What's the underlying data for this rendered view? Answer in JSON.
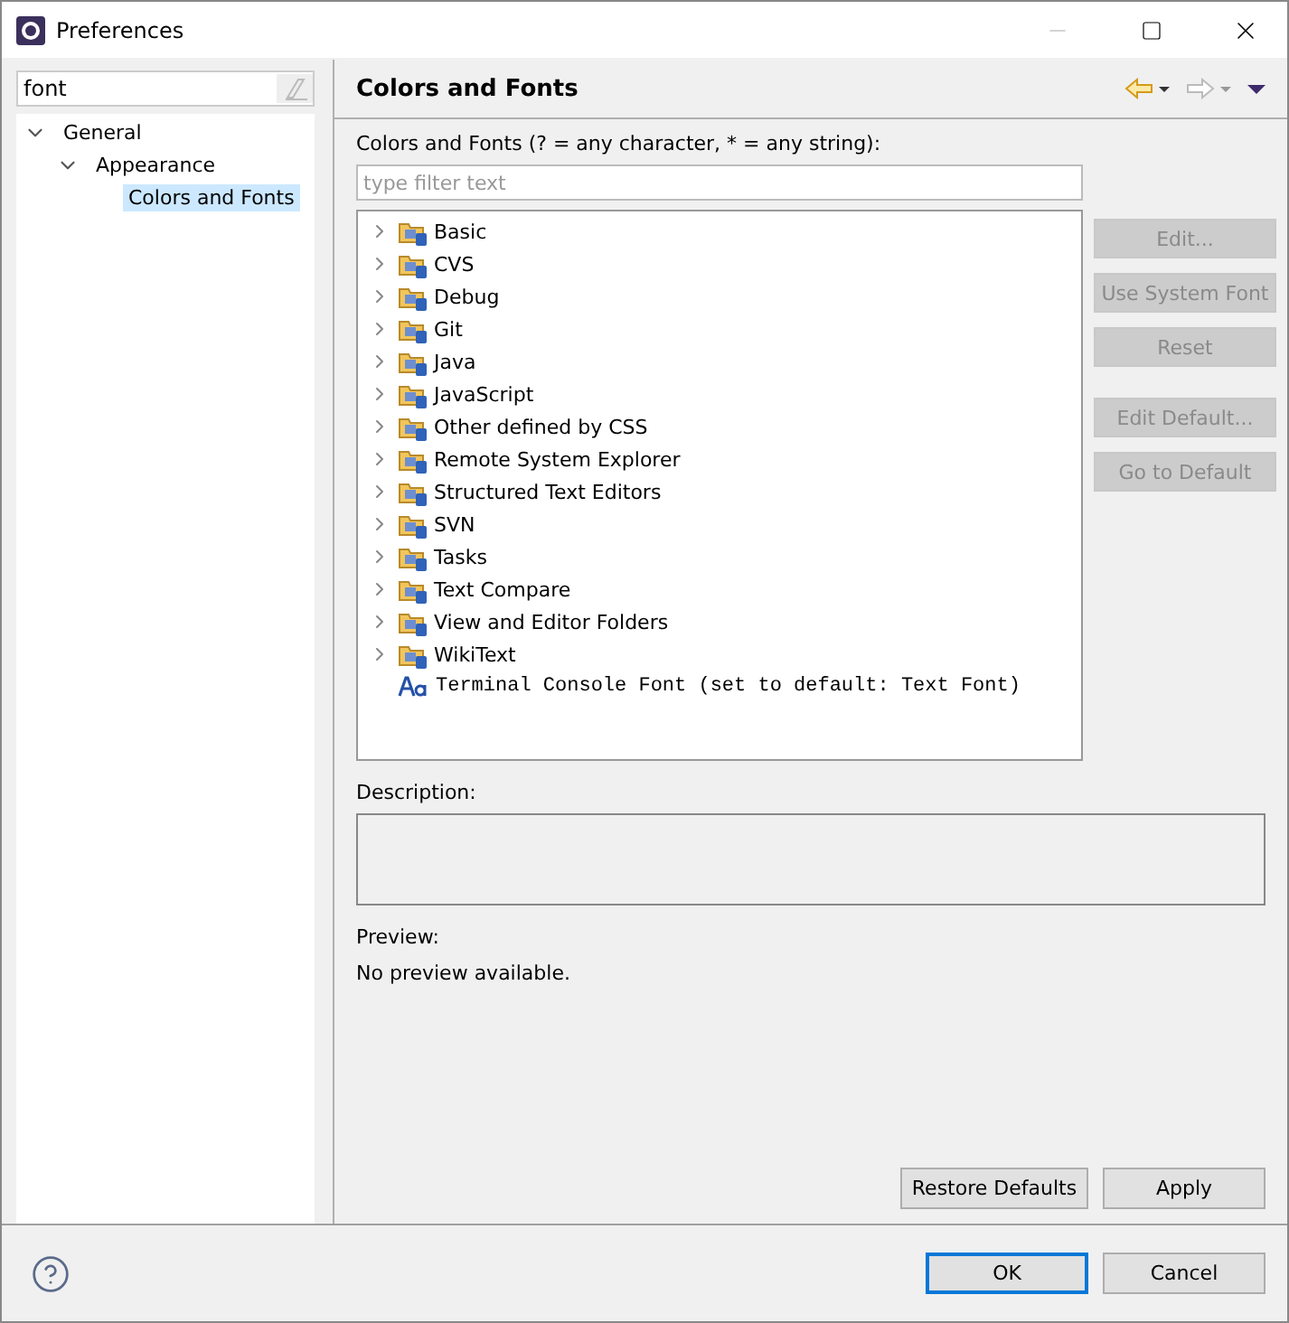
{
  "window": {
    "title": "Preferences"
  },
  "filter": {
    "value": "font"
  },
  "nav_tree": [
    {
      "label": "General",
      "expanded": true,
      "selected": false,
      "children": [
        {
          "label": "Appearance",
          "expanded": true,
          "selected": false,
          "children": [
            {
              "label": "Colors and Fonts",
              "selected": true
            }
          ]
        }
      ]
    }
  ],
  "page": {
    "title": "Colors and Fonts",
    "filter_label": "Colors and Fonts (? = any character, * = any string):",
    "filter_placeholder": "type filter text",
    "items": [
      {
        "kind": "category",
        "label": "Basic"
      },
      {
        "kind": "category",
        "label": "CVS"
      },
      {
        "kind": "category",
        "label": "Debug"
      },
      {
        "kind": "category",
        "label": "Git"
      },
      {
        "kind": "category",
        "label": "Java"
      },
      {
        "kind": "category",
        "label": "JavaScript"
      },
      {
        "kind": "category",
        "label": "Other defined by CSS"
      },
      {
        "kind": "category",
        "label": "Remote System Explorer"
      },
      {
        "kind": "category",
        "label": "Structured Text Editors"
      },
      {
        "kind": "category",
        "label": "SVN"
      },
      {
        "kind": "category",
        "label": "Tasks"
      },
      {
        "kind": "category",
        "label": "Text Compare"
      },
      {
        "kind": "category",
        "label": "View and Editor Folders"
      },
      {
        "kind": "category",
        "label": "WikiText"
      },
      {
        "kind": "font",
        "label": "Terminal Console Font (set to default: Text Font)"
      }
    ],
    "side_button_groups": [
      {
        "buttons": [
          {
            "label": "Edit...",
            "disabled": true
          },
          {
            "label": "Use System Font",
            "disabled": true
          },
          {
            "label": "Reset",
            "disabled": true
          }
        ]
      },
      {
        "buttons": [
          {
            "label": "Edit Default...",
            "disabled": true
          },
          {
            "label": "Go to Default",
            "disabled": true
          }
        ]
      }
    ],
    "description_label": "Description:",
    "preview_label": "Preview:",
    "preview_text": "No preview available.",
    "page_buttons": [
      "Restore Defaults",
      "Apply"
    ]
  },
  "dialog_buttons": [
    {
      "label": "OK",
      "default": true
    },
    {
      "label": "Cancel",
      "default": false
    }
  ]
}
